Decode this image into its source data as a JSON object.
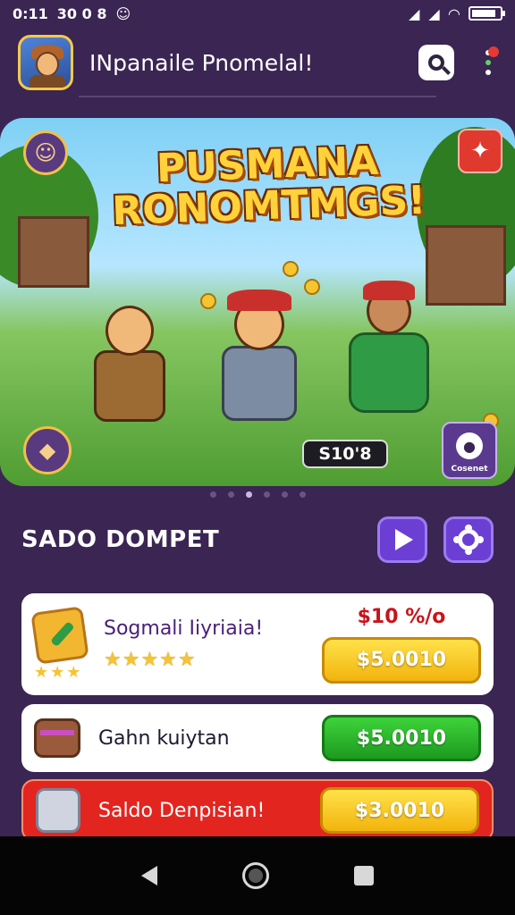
{
  "status_bar": {
    "time": "0:11",
    "extra": "30 0 8"
  },
  "header": {
    "title": "INpanaile Pnomelal!"
  },
  "banner": {
    "title_line1": "PUSMANA",
    "title_line2": "RONOMTMGS!",
    "price_tag": "S10'8",
    "badge_label": "Cosenet"
  },
  "carousel": {
    "dot_count": 6,
    "active_index": 2
  },
  "section": {
    "title": "SADO DOMPET"
  },
  "cards": [
    {
      "title": "Sogmali Iiyriaia!",
      "price_tag": "$10 %/o",
      "stars": "★★★★★",
      "small_stars": "★★★",
      "button_label": "$5.0010"
    },
    {
      "title": "Gahn kuiytan",
      "button_label": "$5.0010"
    },
    {
      "title": "Saldo Denpisian!",
      "button_label": "$3.0010"
    }
  ],
  "colors": {
    "background": "#3a2553",
    "accent_purple": "#6b3fd4",
    "buy_yellow": "#f2b40d",
    "buy_green": "#1d9a20",
    "promo_red": "#e3251f"
  },
  "icons": {
    "header_search": "search-icon",
    "header_menu": "more-vert-icon",
    "section_play": "play-icon",
    "section_settings": "gear-icon"
  }
}
